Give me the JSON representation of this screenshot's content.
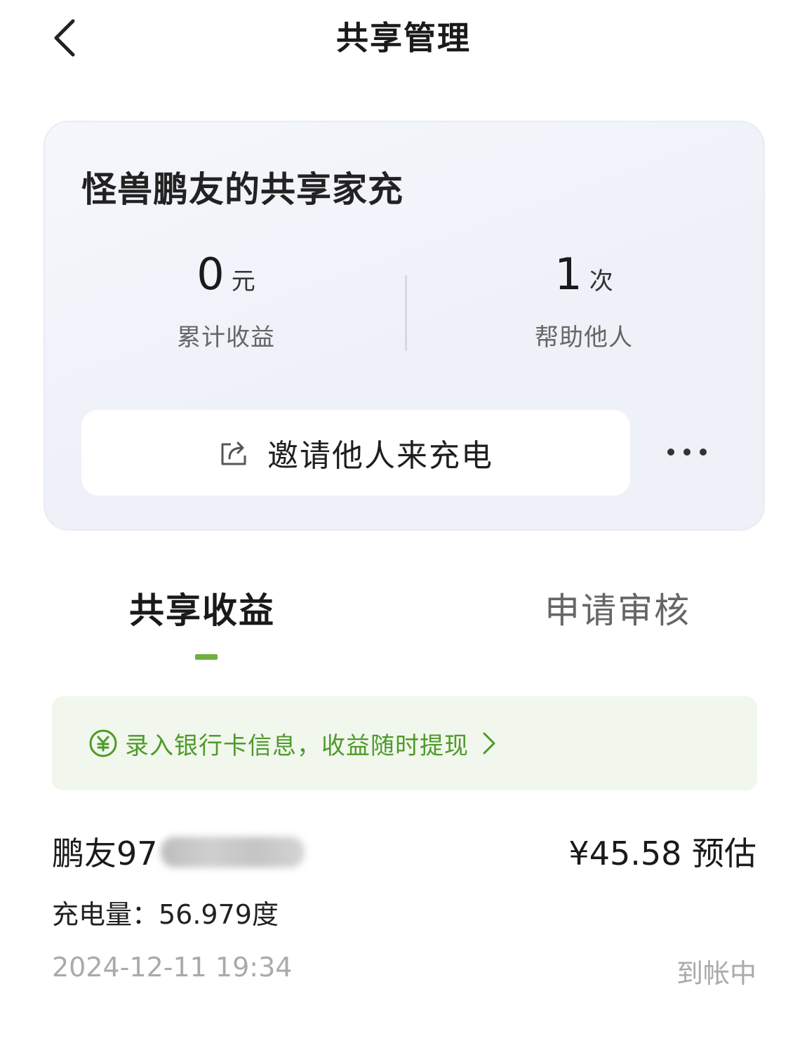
{
  "header": {
    "title": "共享管理",
    "back_icon": "chevron-left-icon"
  },
  "card": {
    "title": "怪兽鹏友的共享家充",
    "stats": [
      {
        "value": "0",
        "unit": "元",
        "label": "累计收益"
      },
      {
        "value": "1",
        "unit": "次",
        "label": "帮助他人"
      }
    ],
    "invite_button": {
      "label": "邀请他人来充电",
      "icon": "share-icon"
    },
    "more_icon": "more-horizontal-icon"
  },
  "tabs": [
    {
      "label": "共享收益",
      "active": true
    },
    {
      "label": "申请审核",
      "active": false
    }
  ],
  "banner": {
    "text": "录入银行卡信息，收益随时提现",
    "icon": "yuan-circle-icon",
    "arrow_icon": "chevron-right-icon",
    "color": "#4e9a2a"
  },
  "records": [
    {
      "name": "鹏友97",
      "amount": "¥45.58 预估",
      "energy": "充电量：56.979度",
      "time": "2024-12-11 19:34",
      "status": "到帐中"
    }
  ],
  "colors": {
    "accent": "#6fb03e",
    "banner_bg": "#f1f7ec",
    "card_bg": "#eef1f8"
  }
}
